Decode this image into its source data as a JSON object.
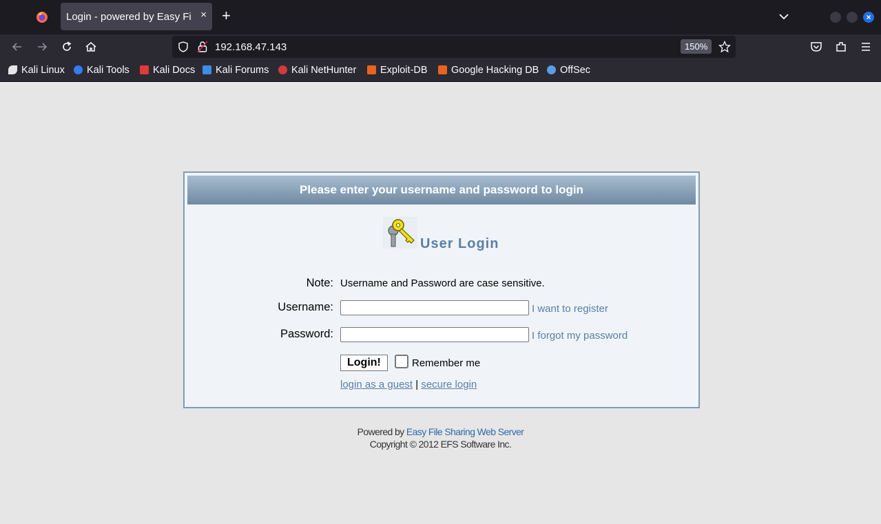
{
  "browser": {
    "tab_title": "Login - powered by Easy File",
    "tab_close": "×",
    "new_tab": "+",
    "url": "192.168.47.143",
    "zoom": "150%",
    "icons": [
      "firefox-icon",
      "back-icon",
      "forward-icon",
      "reload-icon",
      "home-icon",
      "shield-icon",
      "lock-icon",
      "star-icon",
      "pocket-icon",
      "extensions-icon",
      "menu-icon",
      "list-tabs-icon",
      "minimize-icon",
      "maximize-icon",
      "close-icon"
    ],
    "bookmarks": [
      {
        "label": "Kali Linux",
        "color": "#e6e6e6"
      },
      {
        "label": "Kali Tools",
        "color": "#367bf0"
      },
      {
        "label": "Kali Docs",
        "color": "#e03a3a"
      },
      {
        "label": "Kali Forums",
        "color": "#3a8ee6"
      },
      {
        "label": "Kali NetHunter",
        "color": "#d63a3a"
      },
      {
        "label": "Exploit-DB",
        "color": "#e8641e"
      },
      {
        "label": "Google Hacking DB",
        "color": "#e8641e"
      },
      {
        "label": "OffSec",
        "color": "#5b9ce6"
      }
    ]
  },
  "page": {
    "header": "Please enter your username and password to login",
    "title": "User Login",
    "note_label": "Note:",
    "note_text": "Username and Password are case sensitive.",
    "username_label": "Username:",
    "username_value": "",
    "register_link": "I want to register",
    "password_label": "Password:",
    "password_value": "",
    "forgot_link": "I forgot my password",
    "login_button": "Login!",
    "remember_label": "Remember me",
    "guest_link": "login as a guest",
    "separator": "|",
    "secure_link": "secure login",
    "footer_powered_prefix": "Powered by ",
    "footer_powered_link": "Easy File Sharing Web Server",
    "footer_copyright": "Copyright © 2012 EFS Software Inc."
  },
  "colors": {
    "accent": "#5a7fa3",
    "header_gradient_top": "#a8bccf",
    "header_gradient_bottom": "#6f8aa2",
    "box_border": "#7d9db4"
  }
}
